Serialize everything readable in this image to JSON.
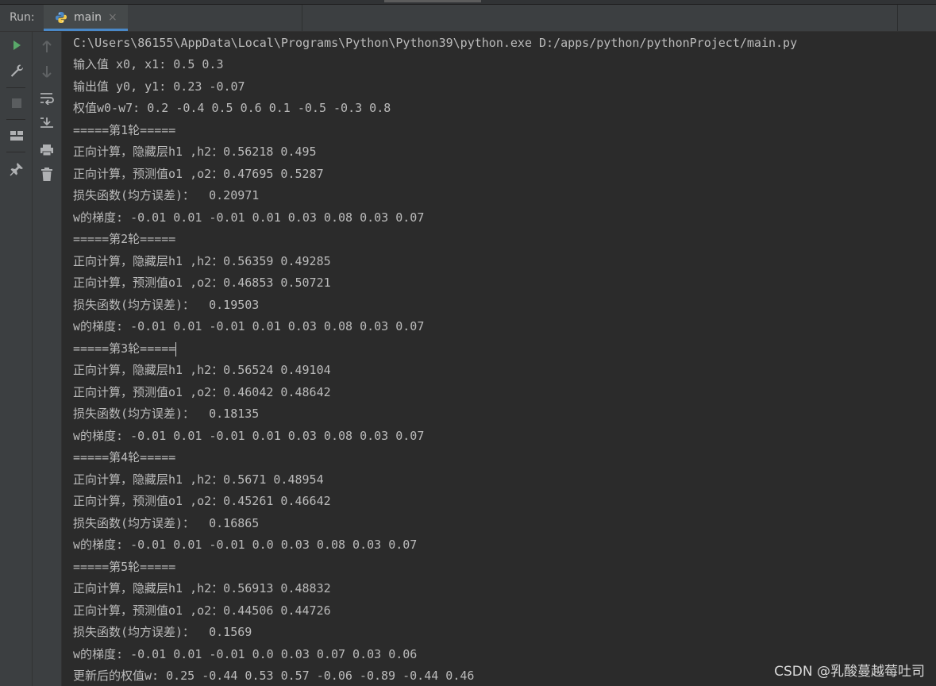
{
  "panel": {
    "run_label": "Run:",
    "tab_label": "main",
    "tab_close": "×"
  },
  "console_lines": [
    "C:\\Users\\86155\\AppData\\Local\\Programs\\Python\\Python39\\python.exe D:/apps/python/pythonProject/main.py",
    "输入值 x0, x1: 0.5 0.3",
    "输出值 y0, y1: 0.23 -0.07",
    "权值w0-w7: 0.2 -0.4 0.5 0.6 0.1 -0.5 -0.3 0.8",
    "=====第1轮=====",
    "正向计算，隐藏层h1 ,h2：0.56218 0.495",
    "正向计算，预测值o1 ,o2：0.47695 0.5287",
    "损失函数(均方误差)：  0.20971",
    "w的梯度: -0.01 0.01 -0.01 0.01 0.03 0.08 0.03 0.07",
    "=====第2轮=====",
    "正向计算，隐藏层h1 ,h2：0.56359 0.49285",
    "正向计算，预测值o1 ,o2：0.46853 0.50721",
    "损失函数(均方误差)：  0.19503",
    "w的梯度: -0.01 0.01 -0.01 0.01 0.03 0.08 0.03 0.07",
    "=====第3轮=====",
    "正向计算，隐藏层h1 ,h2：0.56524 0.49104",
    "正向计算，预测值o1 ,o2：0.46042 0.48642",
    "损失函数(均方误差)：  0.18135",
    "w的梯度: -0.01 0.01 -0.01 0.01 0.03 0.08 0.03 0.07",
    "=====第4轮=====",
    "正向计算，隐藏层h1 ,h2：0.5671 0.48954",
    "正向计算，预测值o1 ,o2：0.45261 0.46642",
    "损失函数(均方误差)：  0.16865",
    "w的梯度: -0.01 0.01 -0.01 0.0 0.03 0.08 0.03 0.07",
    "=====第5轮=====",
    "正向计算，隐藏层h1 ,h2：0.56913 0.48832",
    "正向计算，预测值o1 ,o2：0.44506 0.44726",
    "损失函数(均方误差)：  0.1569",
    "w的梯度: -0.01 0.01 -0.01 0.0 0.03 0.07 0.03 0.06",
    "更新后的权值w: 0.25 -0.44 0.53 0.57 -0.06 -0.89 -0.44 0.46"
  ],
  "watermark": "CSDN @乳酸蔓越莓吐司",
  "icons": {
    "tab": "python-icon",
    "close": "close-icon",
    "toolbar_left": [
      "run-icon",
      "wrench-icon",
      "stop-icon",
      "layout-icon",
      "pin-icon"
    ],
    "toolbar_right": [
      "arrow-up-icon",
      "arrow-down-icon",
      "soft-wrap-icon",
      "scroll-to-end-icon",
      "print-icon",
      "trash-icon"
    ]
  },
  "colors": {
    "accent": "#4a88c7",
    "run_green": "#59a869",
    "text": "#bbbbbb",
    "background": "#2b2b2b"
  }
}
